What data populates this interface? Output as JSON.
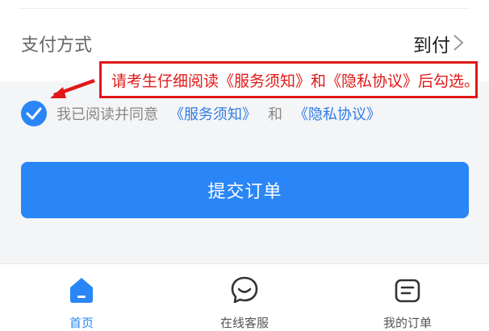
{
  "payment": {
    "label": "支付方式",
    "value": "到付"
  },
  "annotation": {
    "text": "请考生仔细阅读《服务须知》和《隐私协议》后勾选。"
  },
  "agreement": {
    "prefix": "我已阅读并同意",
    "link1": "《服务须知》",
    "conj": "和",
    "link2": "《隐私协议》",
    "checked": true
  },
  "submit": {
    "label": "提交订单"
  },
  "tabbar": {
    "items": [
      {
        "label": "首页",
        "icon": "home-icon",
        "active": true
      },
      {
        "label": "在线客服",
        "icon": "chat-icon",
        "active": false
      },
      {
        "label": "我的订单",
        "icon": "order-list-icon",
        "active": false
      }
    ]
  },
  "colors": {
    "accent": "#2a86f7",
    "annotation": "#e01818"
  }
}
